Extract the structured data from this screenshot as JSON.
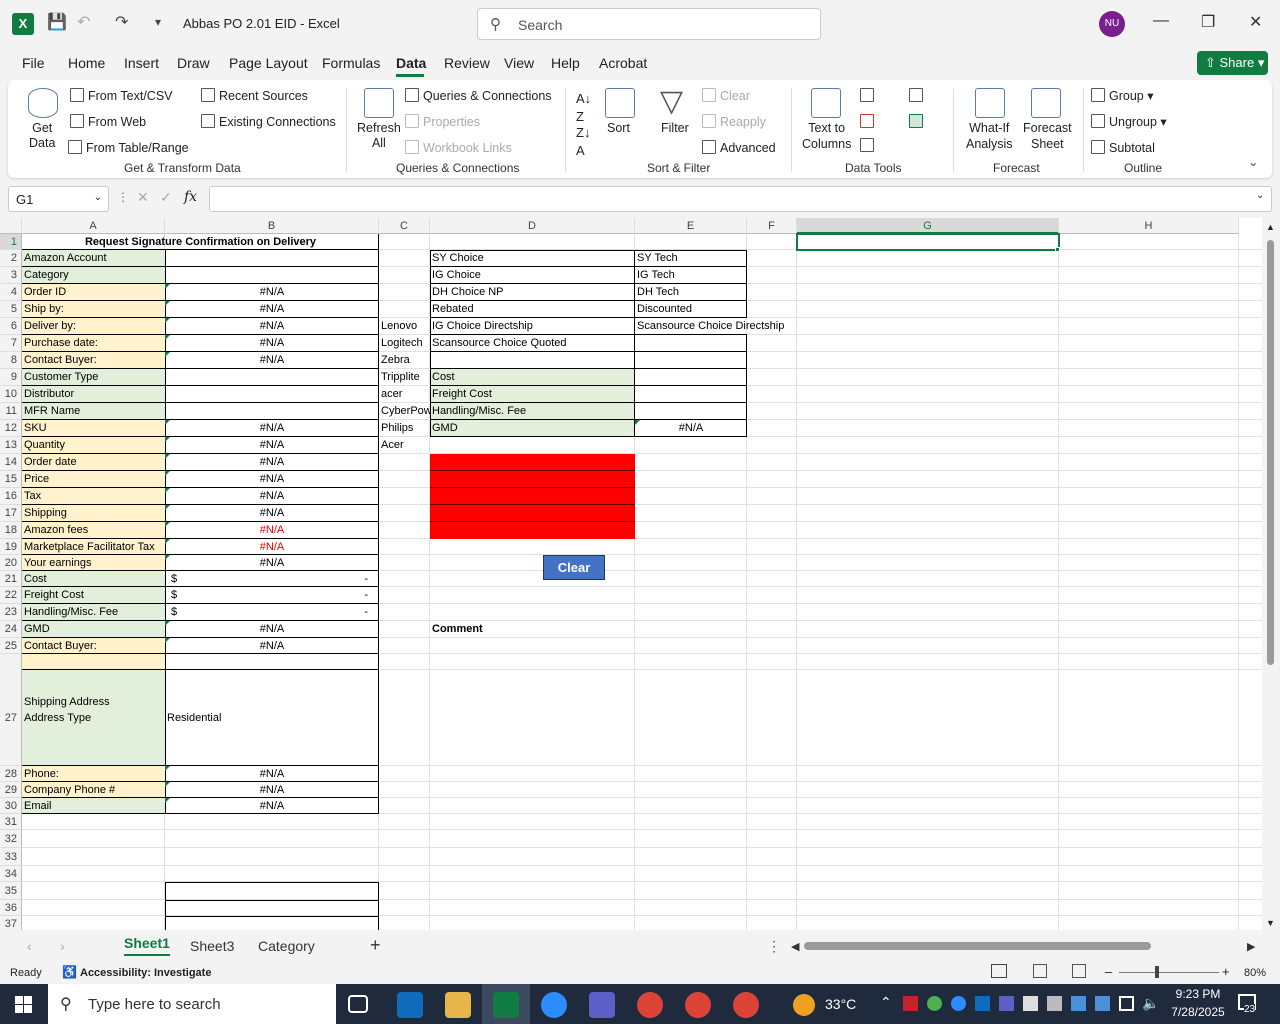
{
  "window": {
    "title": "Abbas PO 2.01  EID  -  Excel",
    "search_placeholder": "Search",
    "avatar": "NU",
    "app_icon": "X"
  },
  "menu": [
    "File",
    "Home",
    "Insert",
    "Draw",
    "Page Layout",
    "Formulas",
    "Data",
    "Review",
    "View",
    "Help",
    "Acrobat"
  ],
  "share_label": "Share",
  "ribbon": {
    "get_data": "Get\nData",
    "from_text_csv": "From Text/CSV",
    "from_web": "From Web",
    "from_table_range": "From Table/Range",
    "recent_sources": "Recent Sources",
    "existing_connections": "Existing Connections",
    "group_get_transform": "Get & Transform Data",
    "refresh_all": "Refresh\nAll",
    "queries_connections": "Queries & Connections",
    "properties": "Properties",
    "workbook_links": "Workbook Links",
    "group_queries": "Queries & Connections",
    "sort": "Sort",
    "filter": "Filter",
    "clear": "Clear",
    "reapply": "Reapply",
    "advanced": "Advanced",
    "group_sort_filter": "Sort & Filter",
    "text_to_columns": "Text to\nColumns",
    "group_data_tools": "Data Tools",
    "what_if": "What-If\nAnalysis",
    "forecast_sheet": "Forecast\nSheet",
    "group_forecast": "Forecast",
    "group": "Group",
    "ungroup": "Ungroup",
    "subtotal": "Subtotal",
    "group_outline": "Outline"
  },
  "formula_bar": {
    "name_box": "G1",
    "fx": "fx",
    "value": ""
  },
  "columns": [
    "A",
    "B",
    "C",
    "D",
    "E",
    "F",
    "G",
    "H"
  ],
  "sheet": {
    "title": "Request Signature Confirmation on Delivery",
    "labels_a": [
      "Amazon Account",
      "Category",
      "Order ID",
      "Ship by:",
      "Deliver by:",
      "Purchase date:",
      "Contact Buyer:",
      "Customer Type",
      "Distributor",
      "MFR Name",
      "SKU",
      "Quantity",
      "Order date",
      "Price",
      "Tax",
      "Shipping",
      "Amazon fees",
      "Marketplace Facilitator Tax",
      "Your earnings",
      "Cost",
      "Freight Cost",
      "Handling/Misc. Fee",
      "GMD",
      "Contact Buyer:",
      "Shipping Address",
      "Address Type",
      "Phone:",
      "Company Phone #",
      "Email"
    ],
    "values_b": {
      "4": "#N/A",
      "5": "#N/A",
      "6": "#N/A",
      "7": "#N/A",
      "8": "#N/A",
      "12": "#N/A",
      "13": "#N/A",
      "14": "#N/A",
      "15": "#N/A",
      "16": "#N/A",
      "17": "#N/A",
      "18": "#N/A",
      "19": "#N/A",
      "20": "#N/A",
      "24": "#N/A",
      "25": "#N/A",
      "27": "Residential",
      "28": "#N/A",
      "29": "#N/A",
      "30": "#N/A"
    },
    "currency_symbol": "$",
    "currency_dash": "-",
    "brands_c": [
      "Lenovo",
      "Logitech",
      "Zebra",
      "Tripplite",
      "acer",
      "CyberPower",
      "Philips",
      "Acer"
    ],
    "d_list": [
      "SY Choice",
      "IG Choice",
      "DH Choice NP",
      " Rebated",
      "IG Choice Directship",
      "Scansource Choice Quoted",
      ""
    ],
    "e_list": [
      "SY Tech",
      "IG Tech",
      "DH Tech",
      " Discounted",
      "Scansource Choice Directship",
      "",
      ""
    ],
    "d_cost": [
      "Cost",
      "Freight Cost",
      "Handling/Misc. Fee",
      "GMD"
    ],
    "e_gmd": "#N/A",
    "clear_button": "Clear",
    "comment_label": "Comment"
  },
  "sheet_tabs": [
    "Sheet1",
    "Sheet3",
    "Category"
  ],
  "status": {
    "ready": "Ready",
    "accessibility": "Accessibility: Investigate",
    "zoom": "80%"
  },
  "taskbar": {
    "search_placeholder": "Type here to search",
    "temperature": "33°C",
    "time": "9:23 PM",
    "date": "7/28/2025",
    "notification_count": "23"
  },
  "colors": {
    "excel_green": "#107c41",
    "label_yellow": "#fff2cc",
    "label_green": "#e2efda",
    "red_fill": "#ff0000",
    "clear_btn": "#4472c4"
  }
}
